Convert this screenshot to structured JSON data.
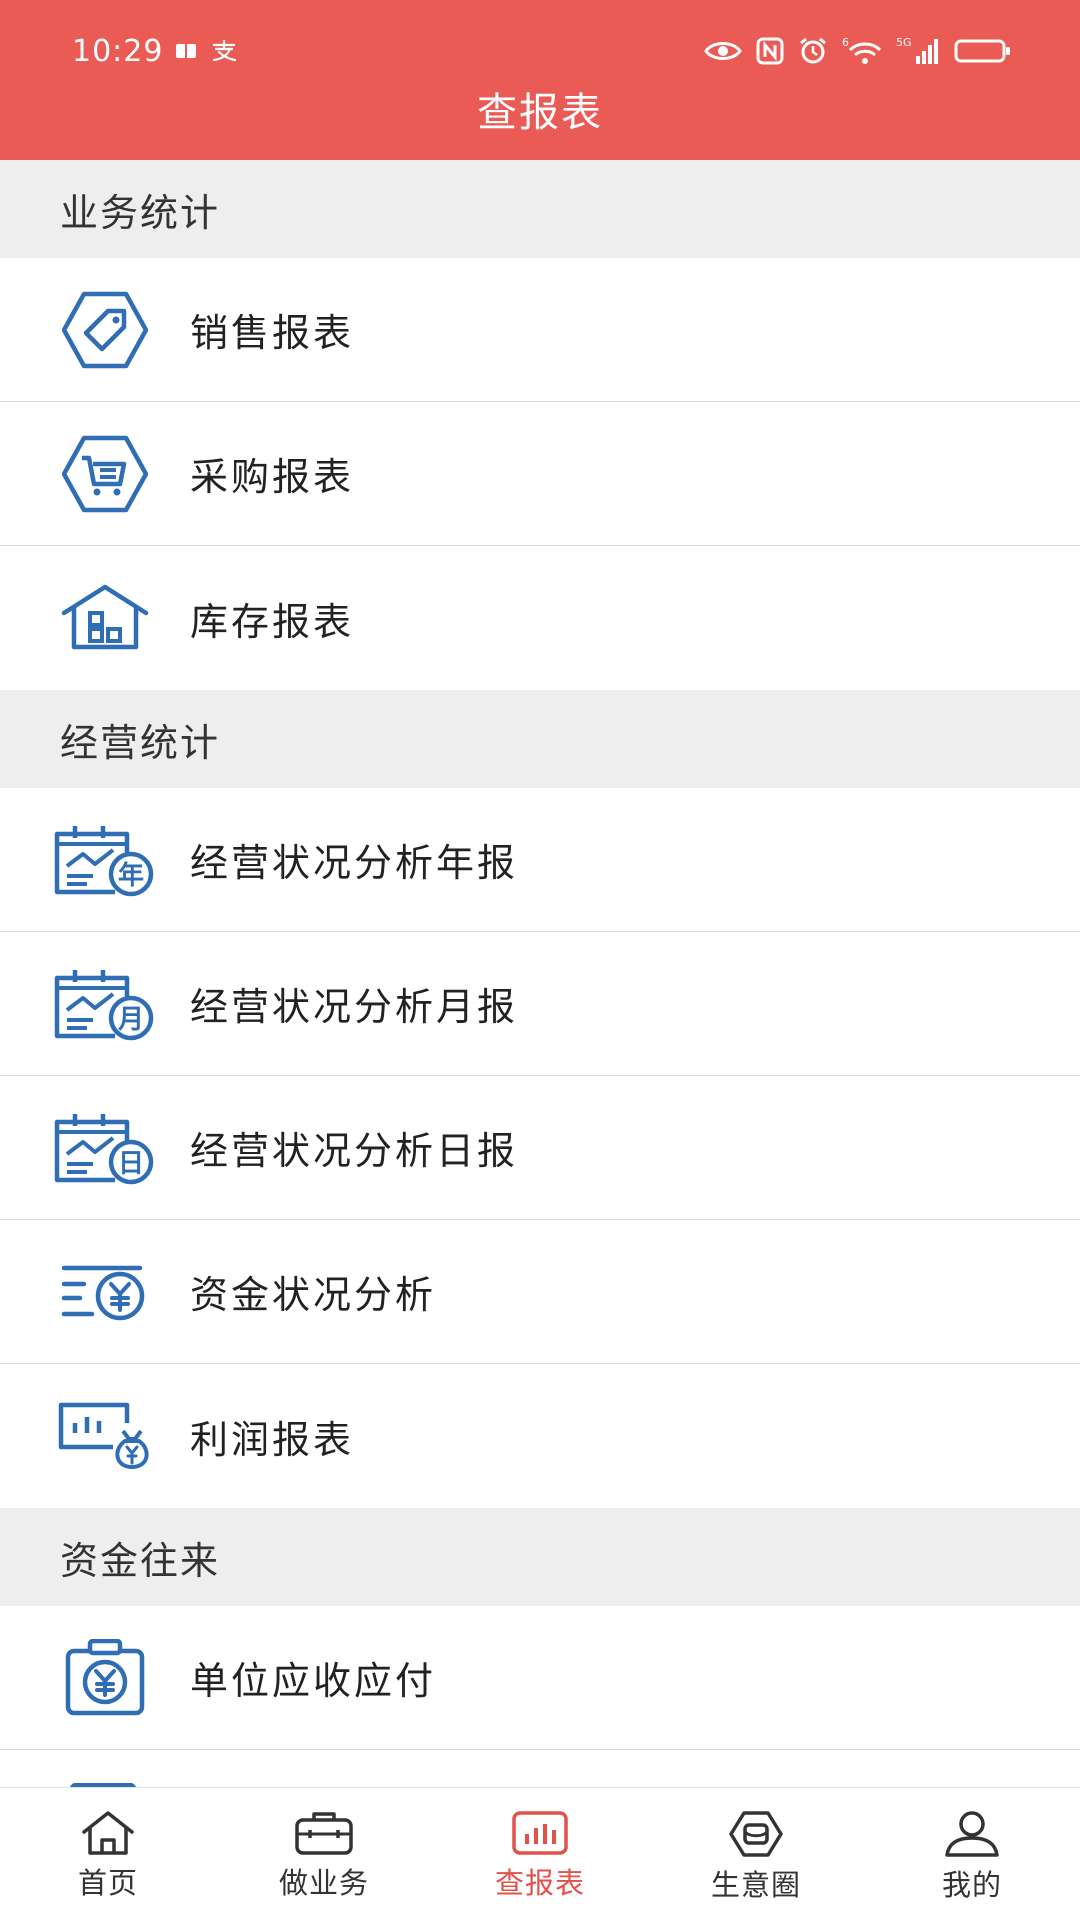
{
  "status_bar": {
    "time": "10:29",
    "network_label": "5G",
    "sim_label": "6"
  },
  "header": {
    "title": "查报表"
  },
  "sections": [
    {
      "title": "业务统计",
      "items": [
        {
          "label": "销售报表",
          "icon": "price-tag-icon"
        },
        {
          "label": "采购报表",
          "icon": "shopping-cart-icon"
        },
        {
          "label": "库存报表",
          "icon": "warehouse-icon"
        }
      ]
    },
    {
      "title": "经营统计",
      "items": [
        {
          "label": "经营状况分析年报",
          "icon": "calendar-chart-year-icon",
          "badge": "年"
        },
        {
          "label": "经营状况分析月报",
          "icon": "calendar-chart-month-icon",
          "badge": "月"
        },
        {
          "label": "经营状况分析日报",
          "icon": "calendar-chart-day-icon",
          "badge": "日"
        },
        {
          "label": "资金状况分析",
          "icon": "yuan-flow-icon"
        },
        {
          "label": "利润报表",
          "icon": "profit-chart-icon"
        }
      ]
    },
    {
      "title": "资金往来",
      "items": [
        {
          "label": "单位应收应付",
          "icon": "yuan-receipt-icon"
        }
      ]
    }
  ],
  "bottom_nav": [
    {
      "label": "首页",
      "icon": "home-icon"
    },
    {
      "label": "做业务",
      "icon": "briefcase-icon"
    },
    {
      "label": "查报表",
      "icon": "bar-chart-icon",
      "active": true
    },
    {
      "label": "生意圈",
      "icon": "community-icon"
    },
    {
      "label": "我的",
      "icon": "user-icon"
    }
  ],
  "colors": {
    "header_bg": "#EB5B55",
    "section_bg": "#EEEEEE",
    "icon_blue": "#2F6DB5",
    "nav_active": "#E2514A"
  }
}
